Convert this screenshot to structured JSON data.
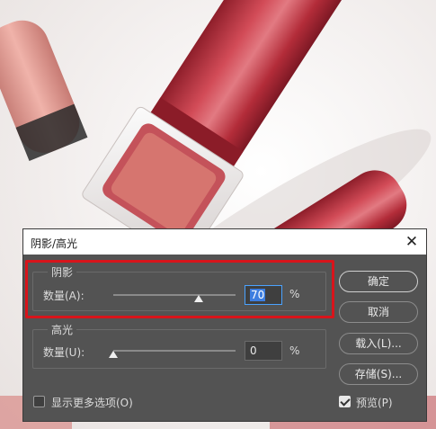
{
  "dialog": {
    "title": "阴影/高光",
    "close_glyph": "✕",
    "shadows": {
      "legend": "阴影",
      "amount_label": "数量(A):",
      "amount_value": "70",
      "amount_level_percent": 70,
      "unit": "%"
    },
    "highlights": {
      "legend": "高光",
      "amount_label": "数量(U):",
      "amount_value": "0",
      "amount_level_percent": 0,
      "unit": "%"
    },
    "buttons": {
      "ok": "确定",
      "cancel": "取消",
      "load": "载入(L)...",
      "save": "存储(S)..."
    },
    "show_more_options": {
      "label": "显示更多选项(O)",
      "checked": false
    },
    "preview": {
      "label": "预览(P)",
      "checked": true
    }
  },
  "colors": {
    "dialog_bg": "#535353",
    "highlight_border": "#d8141b",
    "lipstick_red": "#c23a45",
    "selection_blue": "#3d7ee0"
  }
}
